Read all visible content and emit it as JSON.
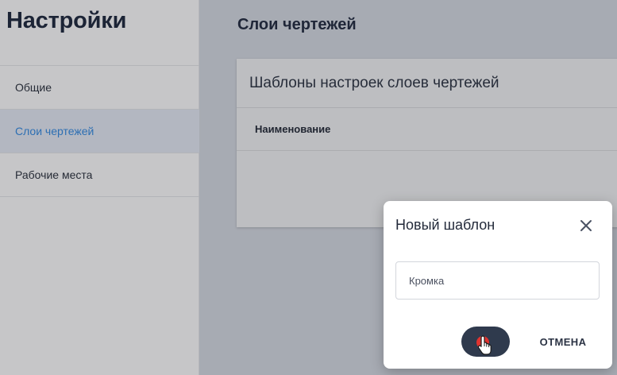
{
  "sidebar": {
    "title": "Настройки",
    "items": [
      {
        "label": "Общие",
        "active": false
      },
      {
        "label": "Слои чертежей",
        "active": true
      },
      {
        "label": "Рабочие места",
        "active": false
      }
    ]
  },
  "main": {
    "title": "Слои чертежей",
    "card": {
      "title": "Шаблоны настроек слоев чертежей",
      "columns": [
        "Наименование"
      ]
    }
  },
  "dialog": {
    "title": "Новый шаблон",
    "input_value": "Кромка",
    "cancel_label": "ОТМЕНА",
    "close_icon": "close-icon",
    "save_icon": "hand-pointer-icon"
  },
  "colors": {
    "active_nav_text": "#2d6fb3",
    "primary_button": "#2f3a4d",
    "click_indicator": "#e0332f"
  }
}
